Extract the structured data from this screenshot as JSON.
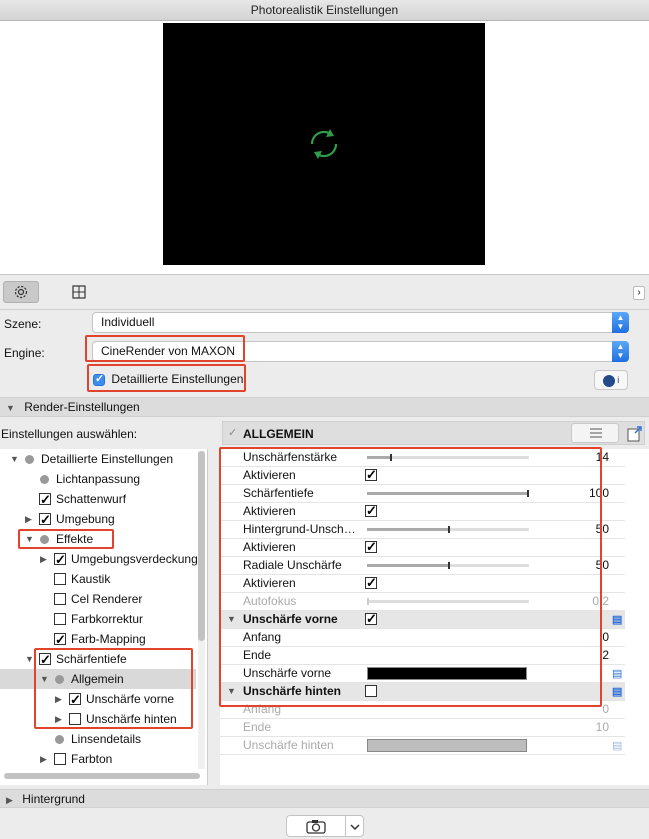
{
  "window": {
    "title": "Photorealistik Einstellungen"
  },
  "toolbar": {
    "tabs": [
      {
        "icon": "gear-icon",
        "active": true
      },
      {
        "icon": "grid-icon",
        "active": false
      }
    ],
    "expand_icon": "chevron-right-icon",
    "expand_glyph": "›"
  },
  "scene": {
    "label": "Szene:",
    "value": "Individuell"
  },
  "engine": {
    "label": "Engine:",
    "value": "CineRender von MAXON"
  },
  "detailed": {
    "label": "Detaillierte Einstellungen",
    "checked": true
  },
  "cinema_button": {
    "icon": "cinema4d-icon",
    "text": "i"
  },
  "sections": {
    "render": "Render-Einstellungen",
    "background": "Hintergrund"
  },
  "select_label": "Einstellungen auswählen:",
  "panel_header": {
    "title": "ALLGEMEIN",
    "check": "✓"
  },
  "tree": [
    {
      "label": "Detaillierte Einstellungen",
      "type": "dot",
      "expand": "open"
    },
    {
      "label": "Lichtanpassung",
      "type": "dot"
    },
    {
      "label": "Schattenwurf",
      "type": "check",
      "checked": true
    },
    {
      "label": "Umgebung",
      "type": "check",
      "checked": true,
      "expand": "closed"
    },
    {
      "label": "Effekte",
      "type": "dot",
      "expand": "open"
    },
    {
      "label": "Umgebungsverdeckung",
      "type": "check",
      "checked": true,
      "expand": "closed"
    },
    {
      "label": "Kaustik",
      "type": "check",
      "checked": false
    },
    {
      "label": "Cel Renderer",
      "type": "check",
      "checked": false
    },
    {
      "label": "Farbkorrektur",
      "type": "check",
      "checked": false
    },
    {
      "label": "Farb-Mapping",
      "type": "check",
      "checked": true
    },
    {
      "label": "Schärfentiefe",
      "type": "check",
      "checked": true,
      "expand": "open"
    },
    {
      "label": "Allgemein",
      "type": "dot",
      "expand": "open",
      "selected": true
    },
    {
      "label": "Unschärfe vorne",
      "type": "check",
      "checked": true,
      "expand": "closed"
    },
    {
      "label": "Unschärfe hinten",
      "type": "check",
      "checked": false,
      "expand": "closed"
    },
    {
      "label": "Linsendetails",
      "type": "dot"
    },
    {
      "label": "Farbton",
      "type": "check",
      "checked": false,
      "expand": "closed"
    }
  ],
  "params": [
    {
      "label": "Unschärfenstärke",
      "kind": "slider",
      "value": "14",
      "level": 0.14
    },
    {
      "label": "Aktivieren",
      "kind": "check",
      "checked": true
    },
    {
      "label": "Schärfentiefe",
      "kind": "slider",
      "value": "100",
      "level": 1.0
    },
    {
      "label": "Aktivieren",
      "kind": "check",
      "checked": true
    },
    {
      "label": "Hintergrund-Unsch…",
      "kind": "slider",
      "value": "50",
      "level": 0.5
    },
    {
      "label": "Aktivieren",
      "kind": "check",
      "checked": true
    },
    {
      "label": "Radiale Unschärfe",
      "kind": "slider",
      "value": "50",
      "level": 0.5
    },
    {
      "label": "Aktivieren",
      "kind": "check",
      "checked": true
    },
    {
      "label": "Autofokus",
      "kind": "slider",
      "value": "0,2",
      "level": 0.0,
      "dim": true
    },
    {
      "label": "Unschärfe vorne",
      "kind": "group",
      "checked": true,
      "icon": true
    },
    {
      "label": "Anfang",
      "kind": "value",
      "value": "0"
    },
    {
      "label": "Ende",
      "kind": "value",
      "value": "2"
    },
    {
      "label": "Unschärfe vorne",
      "kind": "color",
      "color": "#000000",
      "icon": true
    },
    {
      "label": "Unschärfe hinten",
      "kind": "group",
      "checked": false,
      "icon": true
    },
    {
      "label": "Anfang",
      "kind": "value",
      "value": "0",
      "dim": true
    },
    {
      "label": "Ende",
      "kind": "value",
      "value": "10",
      "dim": true
    },
    {
      "label": "Unschärfe hinten",
      "kind": "color",
      "color": "#bdbdbd",
      "dim": true,
      "icon": true
    }
  ],
  "bottom": {
    "camera_icon": "camera-icon",
    "dropdown_icon": "chevron-down-icon"
  },
  "colors": {
    "highlight": "#e2432d",
    "accent": "#3b8ef0",
    "refresh": "#2f9e4a"
  }
}
